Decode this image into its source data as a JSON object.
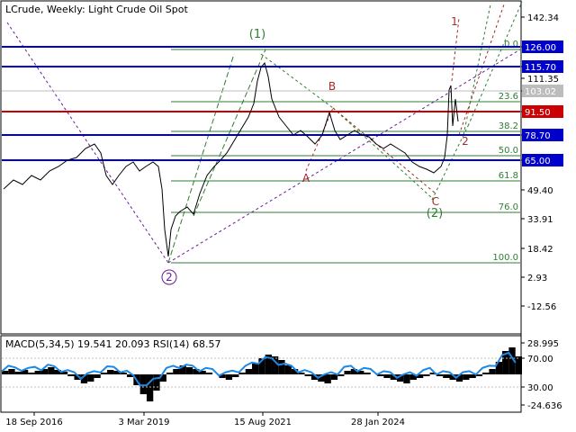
{
  "title": "LCrude, Weekly:  Light Crude Oil Spot",
  "indicator_label": "MACD(5,34,5) 19.541 20.093 RSI(14) 68.57",
  "colors": {
    "price": "#000000",
    "blue_level": "#0000cc",
    "red_level": "#cc0000",
    "fib": "#2e7d32",
    "wave_purple": "#6a1b9a",
    "wave_brown": "#a52a2a",
    "wave_green": "#2e7d32",
    "rsi": "#1e88e5",
    "grid": "#c8c8c8"
  },
  "price_axis_ticks": [
    "142.34",
    "126.00",
    "115.70",
    "111.35",
    "103.02",
    "91.50",
    "78.70",
    "65.00",
    "49.40",
    "33.91",
    "18.42",
    "2.93",
    "-12.56"
  ],
  "level_badges": [
    {
      "label": "126.00",
      "kind": "blue"
    },
    {
      "label": "115.70",
      "kind": "blue"
    },
    {
      "label": "103.02",
      "kind": "gray"
    },
    {
      "label": "91.50",
      "kind": "red"
    },
    {
      "label": "78.70",
      "kind": "blue"
    },
    {
      "label": "65.00",
      "kind": "blue"
    }
  ],
  "fib_labels": [
    "0.0",
    "23.6",
    "38.2",
    "50.0",
    "61.8",
    "76.0",
    "100.0"
  ],
  "wave_labels": {
    "w1": "(1)",
    "w2": "(2)",
    "w_2_circle": "2",
    "A": "A",
    "B": "B",
    "C": "C",
    "one": "1",
    "two": "2"
  },
  "indicator_axis_ticks": [
    "28.995",
    "70.00",
    "30.00",
    "-24.636"
  ],
  "date_labels": [
    "18 Sep 2016",
    "3 Mar 2019",
    "15 Aug 2021",
    "28 Jan 2024"
  ]
}
